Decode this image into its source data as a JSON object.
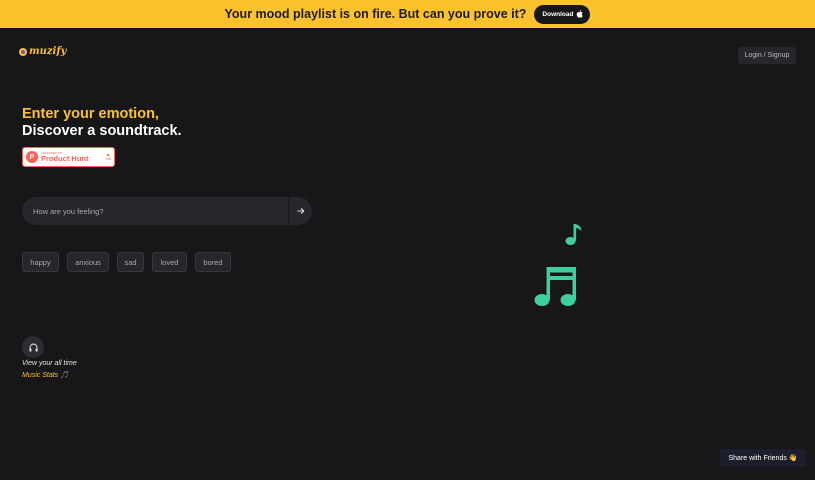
{
  "banner": {
    "text": "Your mood playlist is on fire. But can you prove it?",
    "button_label": "Download",
    "button_icon": "apple-icon",
    "background": "#fcc22b"
  },
  "header": {
    "logo_text": "muzify",
    "login_label": "Login / Signup"
  },
  "hero": {
    "line1": "Enter your emotion,",
    "line2": "Discover a soundtrack.",
    "accent": "#fcc22b"
  },
  "product_hunt": {
    "small_text": "FEATURED ON",
    "name": "Product Hunt",
    "logo_letter": "P",
    "votes": "198"
  },
  "search": {
    "placeholder": "How are you feeling?",
    "submit_icon": "arrow-right-icon"
  },
  "moods": [
    "happy",
    "anxious",
    "sad",
    "loved",
    "bored"
  ],
  "stats": {
    "icon": "headphones-icon",
    "line1": "View your all time",
    "line2": "Music Stats 🎵"
  },
  "share": {
    "label": "Share with Friends 👋"
  },
  "colors": {
    "note_green": "#3ecf9c",
    "background": "#17171a"
  }
}
